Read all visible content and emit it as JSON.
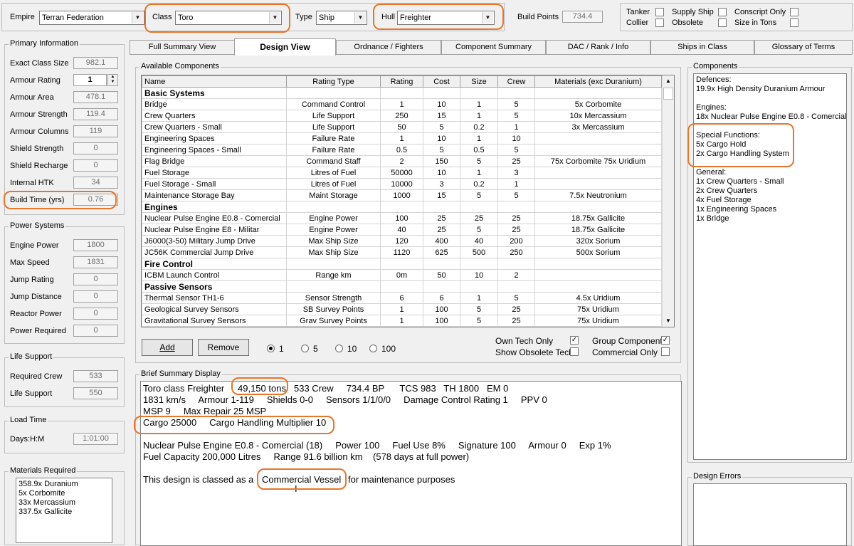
{
  "header": {
    "empire_label": "Empire",
    "empire_value": "Terran Federation",
    "class_label": "Class",
    "class_value": "Toro",
    "type_label": "Type",
    "type_value": "Ship",
    "hull_label": "Hull",
    "hull_value": "Freighter",
    "build_points_label": "Build Points",
    "build_points_value": "734.4",
    "flags": {
      "tanker": "Tanker",
      "collier": "Collier",
      "supply_ship": "Supply Ship",
      "obsolete": "Obsolete",
      "conscript_only": "Conscript Only",
      "size_in_tons": "Size in Tons"
    }
  },
  "tabs": [
    "Full Summary View",
    "Design View",
    "Ordnance / Fighters",
    "Component Summary",
    "DAC / Rank / Info",
    "Ships in Class",
    "Glossary of Terms"
  ],
  "primary": {
    "title": "Primary Information",
    "rows": [
      {
        "label": "Exact Class Size",
        "value": "982.1"
      },
      {
        "label": "Armour Rating",
        "value": "1"
      },
      {
        "label": "Armour Area",
        "value": "478.1"
      },
      {
        "label": "Armour Strength",
        "value": "119.4"
      },
      {
        "label": "Armour Columns",
        "value": "119"
      },
      {
        "label": "Shield Strength",
        "value": "0"
      },
      {
        "label": "Shield Recharge",
        "value": "0"
      },
      {
        "label": "Internal HTK",
        "value": "34"
      },
      {
        "label": "Build Time (yrs)",
        "value": "0.76"
      }
    ]
  },
  "power": {
    "title": "Power Systems",
    "rows": [
      {
        "label": "Engine Power",
        "value": "1800"
      },
      {
        "label": "Max Speed",
        "value": "1831"
      },
      {
        "label": "Jump Rating",
        "value": "0"
      },
      {
        "label": "Jump Distance",
        "value": "0"
      },
      {
        "label": "Reactor Power",
        "value": "0"
      },
      {
        "label": "Power Required",
        "value": "0"
      }
    ]
  },
  "life": {
    "title": "Life Support",
    "rows": [
      {
        "label": "Required Crew",
        "value": "533"
      },
      {
        "label": "Life Support",
        "value": "550"
      }
    ]
  },
  "load": {
    "title": "Load Time",
    "label": "Days:H:M",
    "value": "1:01:00"
  },
  "materials": {
    "title": "Materials Required",
    "items": [
      "358.9x Duranium",
      "5x Corbomite",
      "33x Mercassium",
      "337.5x Gallicite"
    ]
  },
  "available": {
    "title": "Available Components",
    "columns": [
      "Name",
      "Rating Type",
      "Rating",
      "Cost",
      "Size",
      "Crew",
      "Materials (exc Duranium)"
    ],
    "rows": [
      {
        "cat": "Basic Systems"
      },
      {
        "cells": [
          "Bridge",
          "Command Control",
          "1",
          "10",
          "1",
          "5",
          "5x Corbomite"
        ]
      },
      {
        "cells": [
          "Crew Quarters",
          "Life Support",
          "250",
          "15",
          "1",
          "5",
          "10x Mercassium"
        ]
      },
      {
        "cells": [
          "Crew Quarters - Small",
          "Life Support",
          "50",
          "5",
          "0.2",
          "1",
          "3x Mercassium"
        ]
      },
      {
        "cells": [
          "Engineering Spaces",
          "Failure Rate",
          "1",
          "10",
          "1",
          "10",
          ""
        ]
      },
      {
        "cells": [
          "Engineering Spaces - Small",
          "Failure Rate",
          "0.5",
          "5",
          "0.5",
          "5",
          ""
        ]
      },
      {
        "cells": [
          "Flag Bridge",
          "Command Staff",
          "2",
          "150",
          "5",
          "25",
          "75x Corbomite  75x Uridium"
        ]
      },
      {
        "cells": [
          "Fuel Storage",
          "Litres of Fuel",
          "50000",
          "10",
          "1",
          "3",
          ""
        ]
      },
      {
        "cells": [
          "Fuel Storage - Small",
          "Litres of Fuel",
          "10000",
          "3",
          "0.2",
          "1",
          ""
        ]
      },
      {
        "cells": [
          "Maintenance Storage Bay",
          "Maint Storage",
          "1000",
          "15",
          "5",
          "5",
          "7.5x Neutronium"
        ]
      },
      {
        "cat": "Engines"
      },
      {
        "cells": [
          "Nuclear Pulse Engine E0.8 - Comercial",
          "Engine Power",
          "100",
          "25",
          "25",
          "25",
          "18.75x Gallicite"
        ]
      },
      {
        "cells": [
          "Nuclear Pulse Engine E8 - Militar",
          "Engine Power",
          "40",
          "25",
          "5",
          "25",
          "18.75x Gallicite"
        ]
      },
      {
        "cells": [
          "J6000(3-50) Military Jump Drive",
          "Max Ship Size",
          "120",
          "400",
          "40",
          "200",
          "320x Sorium"
        ]
      },
      {
        "cells": [
          "JC56K Commercial Jump Drive",
          "Max Ship Size",
          "1120",
          "625",
          "500",
          "250",
          "500x Sorium"
        ]
      },
      {
        "cat": "Fire Control"
      },
      {
        "cells": [
          "ICBM Launch Control",
          "Range km",
          "0m",
          "50",
          "10",
          "2",
          ""
        ]
      },
      {
        "cat": "Passive Sensors"
      },
      {
        "cells": [
          "Thermal Sensor TH1-6",
          "Sensor Strength",
          "6",
          "6",
          "1",
          "5",
          "4.5x Uridium"
        ]
      },
      {
        "cells": [
          "Geological Survey Sensors",
          "SB Survey Points",
          "1",
          "100",
          "5",
          "25",
          "75x Uridium"
        ]
      },
      {
        "cells": [
          "Gravitational Survey Sensors",
          "Grav Survey Points",
          "1",
          "100",
          "5",
          "25",
          "75x Uridium"
        ]
      }
    ],
    "add_label": "Add",
    "remove_label": "Remove",
    "qty": [
      "1",
      "5",
      "10",
      "100"
    ],
    "own_tech": "Own Tech Only",
    "show_obsolete": "Show Obsolete Tech",
    "group_components": "Group Components",
    "commercial_only": "Commercial Only"
  },
  "summary": {
    "title": "Brief Summary Display",
    "l1a": "Toro class Freighter",
    "l1b": "49,150 tons",
    "l1c": "533 Crew     734.4 BP      TCS 983   TH 1800   EM 0",
    "l2": "1831 km/s     Armour 1-119     Shields 0-0     Sensors 1/1/0/0     Damage Control Rating 1     PPV 0",
    "l3": "MSP 9     Max Repair 25 MSP",
    "l4": "Cargo 25000     Cargo Handling Multiplier 10",
    "l5": "Nuclear Pulse Engine E0.8 - Comercial (18)     Power 100     Fuel Use 8%     Signature 100     Armour 0     Exp 1%",
    "l6": "Fuel Capacity 200,000 Litres     Range 91.6 billion km    (578 days at full power)",
    "l7a": "This design is classed as a",
    "l7b": "Commercial Vessel",
    "l7c": "for maintenance purposes"
  },
  "components": {
    "title": "Components",
    "lines": [
      "Defences:",
      "19.9x High Density Duranium Armour",
      "",
      "Engines:",
      "18x Nuclear Pulse Engine E0.8 - Comercial",
      "",
      "Special Functions:",
      "5x Cargo Hold",
      "2x Cargo Handling System",
      "",
      "General:",
      "1x Crew Quarters - Small",
      "2x Crew Quarters",
      "4x Fuel Storage",
      "1x Engineering Spaces",
      "1x Bridge"
    ]
  },
  "errors": {
    "title": "Design Errors"
  }
}
